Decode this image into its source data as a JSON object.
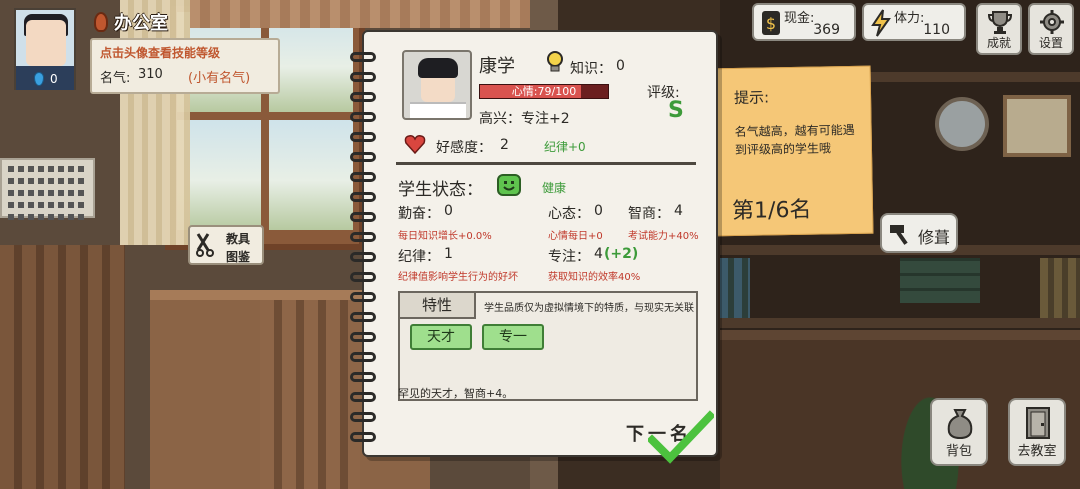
{
  "hud": {
    "location": "办公室",
    "avatar_badge_count": "0",
    "fame_hint": "点击头像查看技能等级",
    "fame_label": "名气:",
    "fame_value": "310",
    "fame_rank": "(小有名气)",
    "tool_label_line1": "教具",
    "tool_label_line2": "图鉴",
    "cash_label": "现金:",
    "cash_value": "369",
    "stamina_label": "体力:",
    "stamina_value": "110",
    "achievements_label": "成就",
    "settings_label": "设置",
    "repair_label": "修葺",
    "bag_label": "背包",
    "classroom_label": "去教室"
  },
  "tip": {
    "title": "提示:",
    "body": "名气越高，越有可能遇到评级高的学生哦",
    "count": "第1/6名"
  },
  "student": {
    "name": "康学",
    "knowledge_label": "知识：",
    "knowledge_value": "0",
    "mood_text": "心情:79/100",
    "mood_fraction": 0.79,
    "grade_label": "评级:",
    "grade_value": "S",
    "happy_line": "高兴：专注+2",
    "favor_label": "好感度：",
    "favor_value": "2",
    "favor_bonus": "纪律+0",
    "state_label": "学生状态：",
    "state_value": "健康",
    "diligence_label": "勤奋：",
    "diligence_value": "0",
    "diligence_note": "每日知识增长+0.0%",
    "mentality_label": "心态：",
    "mentality_value": "0",
    "mentality_note": "心情每日+0",
    "iq_label": "智商：",
    "iq_value": "4",
    "iq_note": "考试能力+40%",
    "discipline_label": "纪律：",
    "discipline_value": "1",
    "discipline_note": "纪律值影响学生行为的好坏",
    "focus_label": "专注：",
    "focus_value": "4",
    "focus_bonus": "(+2)",
    "focus_note": "获取知识的效率40%"
  },
  "traits": {
    "tab_label": "特性",
    "description": "学生品质仅为虚拟情境下的特质，与现实无关联",
    "items": [
      "天才",
      "专一"
    ],
    "detail": "罕见的天才，智商+4。"
  },
  "next_label": "下一名",
  "colors": {
    "accent_green": "#3d9b3a",
    "warning_red": "#c0392b",
    "note_orange": "#f5c777"
  }
}
